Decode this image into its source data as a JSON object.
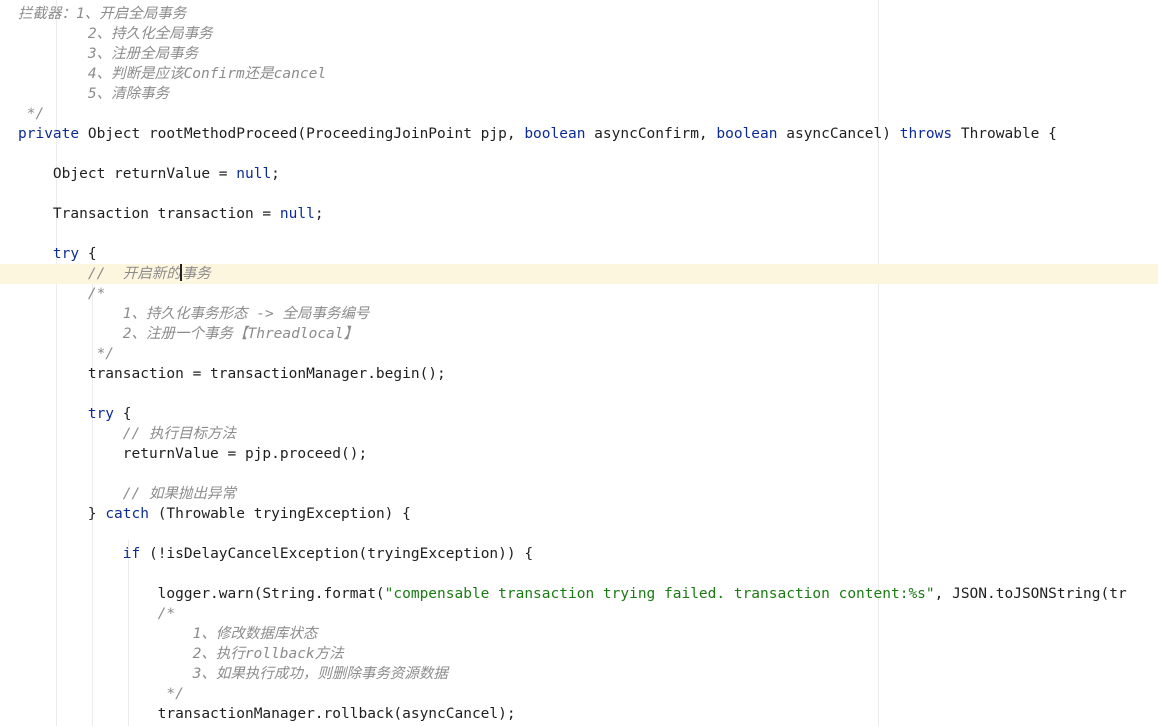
{
  "editor": {
    "lines": [
      {
        "text": "拦截器：1、开启全局事务",
        "kind": "comment"
      },
      {
        "text": "        2、持久化全局事务",
        "kind": "comment"
      },
      {
        "text": "        3、注册全局事务",
        "kind": "comment"
      },
      {
        "text": "        4、判断是应该Confirm还是cancel",
        "kind": "comment"
      },
      {
        "text": "        5、清除事务",
        "kind": "comment"
      },
      {
        "text": " */",
        "kind": "comment"
      },
      {
        "kind": "code",
        "tokens": [
          {
            "t": "private",
            "k": "kw"
          },
          {
            "t": " Object rootMethodProceed(ProceedingJoinPoint pjp, "
          },
          {
            "t": "boolean",
            "k": "kw"
          },
          {
            "t": " asyncConfirm, "
          },
          {
            "t": "boolean",
            "k": "kw"
          },
          {
            "t": " asyncCancel) "
          },
          {
            "t": "throws",
            "k": "kw"
          },
          {
            "t": " Throwable {"
          }
        ]
      },
      {
        "text": "",
        "kind": "blank"
      },
      {
        "kind": "code",
        "tokens": [
          {
            "t": "    Object returnValue = "
          },
          {
            "t": "null",
            "k": "kw"
          },
          {
            "t": ";"
          }
        ]
      },
      {
        "text": "",
        "kind": "blank"
      },
      {
        "kind": "code",
        "tokens": [
          {
            "t": "    Transaction transaction = "
          },
          {
            "t": "null",
            "k": "kw"
          },
          {
            "t": ";"
          }
        ]
      },
      {
        "text": "",
        "kind": "blank"
      },
      {
        "kind": "code",
        "tokens": [
          {
            "t": "    "
          },
          {
            "t": "try",
            "k": "kw"
          },
          {
            "t": " {"
          }
        ]
      },
      {
        "kind": "comment",
        "current": true,
        "text": "        //  开启新的事务"
      },
      {
        "text": "        /*",
        "kind": "comment"
      },
      {
        "text": "            1、持久化事务形态 -> 全局事务编号",
        "kind": "comment"
      },
      {
        "text": "            2、注册一个事务【Threadlocal】",
        "kind": "comment"
      },
      {
        "text": "         */",
        "kind": "comment"
      },
      {
        "text": "        transaction = transactionManager.begin();",
        "kind": "code"
      },
      {
        "text": "",
        "kind": "blank"
      },
      {
        "kind": "code",
        "tokens": [
          {
            "t": "        "
          },
          {
            "t": "try",
            "k": "kw"
          },
          {
            "t": " {"
          }
        ]
      },
      {
        "text": "            // 执行目标方法",
        "kind": "comment"
      },
      {
        "text": "            returnValue = pjp.proceed();",
        "kind": "code"
      },
      {
        "text": "",
        "kind": "blank"
      },
      {
        "text": "            // 如果抛出异常",
        "kind": "comment"
      },
      {
        "kind": "code",
        "tokens": [
          {
            "t": "        } "
          },
          {
            "t": "catch",
            "k": "kw"
          },
          {
            "t": " (Throwable tryingException) {"
          }
        ]
      },
      {
        "text": "",
        "kind": "blank"
      },
      {
        "kind": "code",
        "tokens": [
          {
            "t": "            "
          },
          {
            "t": "if",
            "k": "kw"
          },
          {
            "t": " (!isDelayCancelException(tryingException)) {"
          }
        ]
      },
      {
        "text": "",
        "kind": "blank"
      },
      {
        "kind": "code",
        "tokens": [
          {
            "t": "                logger.warn(String.format("
          },
          {
            "t": "\"compensable transaction trying failed. transaction content:%s\"",
            "k": "str"
          },
          {
            "t": ", JSON.toJSONString(tr"
          }
        ]
      },
      {
        "text": "                /*",
        "kind": "comment"
      },
      {
        "text": "                    1、修改数据库状态",
        "kind": "comment"
      },
      {
        "text": "                    2、执行rollback方法",
        "kind": "comment"
      },
      {
        "text": "                    3、如果执行成功，则删除事务资源数据",
        "kind": "comment"
      },
      {
        "text": "                 */",
        "kind": "comment"
      },
      {
        "text": "                transactionManager.rollback(asyncCancel);",
        "kind": "code"
      }
    ]
  }
}
